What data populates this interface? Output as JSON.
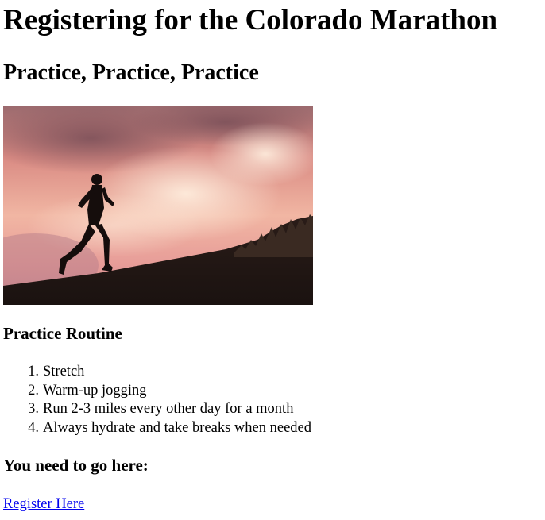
{
  "page": {
    "title": "Registering for the Colorado Marathon",
    "subtitle": "Practice, Practice, Practice",
    "hero_image": {
      "icon": "runner-silhouette-sunset-image"
    },
    "routine": {
      "heading": "Practice Routine",
      "steps": [
        "Stretch",
        "Warm-up jogging",
        "Run 2-3 miles every other day for a month",
        "Always hydrate and take breaks when needed"
      ]
    },
    "go_heading": "You need to go here:",
    "register_link": {
      "label": "Register Here"
    }
  },
  "colors": {
    "link": "#0000ee",
    "text": "#000000",
    "background": "#ffffff"
  }
}
